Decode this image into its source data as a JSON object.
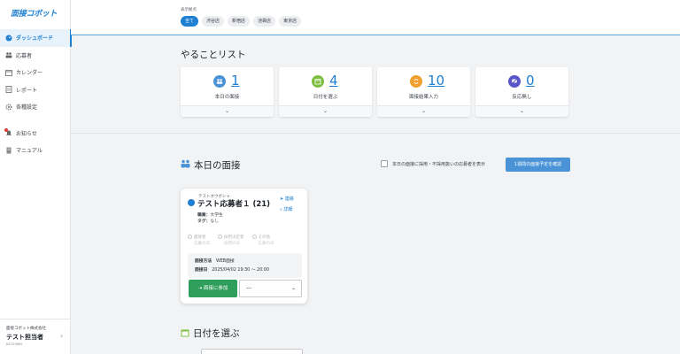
{
  "sidebar": {
    "logo": "面接コボット",
    "items": [
      {
        "label": "ダッシュボード",
        "icon": "dashboard-icon",
        "active": true
      },
      {
        "label": "応募者",
        "icon": "users-icon",
        "active": false
      },
      {
        "label": "カレンダー",
        "icon": "calendar-icon",
        "active": false
      },
      {
        "label": "レポート",
        "icon": "report-icon",
        "active": false
      },
      {
        "label": "各種設定",
        "icon": "gear-icon",
        "active": false
      }
    ],
    "items2": [
      {
        "label": "お知らせ",
        "icon": "bell-icon"
      },
      {
        "label": "マニュアル",
        "icon": "book-icon"
      }
    ],
    "company": "面接コボット株式会社",
    "user": "テスト担当者",
    "user_id": "K87D3885"
  },
  "filter": {
    "label": "表示拠点",
    "chips": [
      "全て",
      "渋谷店",
      "新宿店",
      "池袋店",
      "東京店"
    ]
  },
  "todo": {
    "title": "やることリスト",
    "cards": [
      {
        "count": "1",
        "label": "本日の面接",
        "color": "#4a93d6"
      },
      {
        "count": "4",
        "label": "日付を選ぶ",
        "color": "#7cbf3f"
      },
      {
        "count": "10",
        "label": "面接結果入力",
        "color": "#f0a030"
      },
      {
        "count": "0",
        "label": "反応無し",
        "color": "#5a56c8"
      }
    ]
  },
  "today": {
    "title": "本日の面接",
    "checkbox_label": "本日の面接に採用・不採用扱いの応募者を表示",
    "confirm_button": "1週間の面接予定を確認",
    "card": {
      "kana": "テストオウボシャ",
      "name": "テスト応募者１ (21)",
      "contact": "連絡",
      "detail": "詳細",
      "job_label": "職業：",
      "job": "大学生",
      "tag_label": "タグ：",
      "tag": "なし",
      "steps": [
        {
          "label": "面接者",
          "sub": "応募の日"
        },
        {
          "label": "採用決定者",
          "sub": "採用の日"
        },
        {
          "label": "その他",
          "sub": "応募の日"
        }
      ],
      "method_label": "面接方法",
      "method": "WEB面接",
      "date_label": "面接日",
      "date": "2025/04/02 19:30 〜 20:00",
      "join_button": "面接に参加",
      "select_value": "---"
    }
  },
  "pick_date": {
    "title": "日付を選ぶ"
  }
}
